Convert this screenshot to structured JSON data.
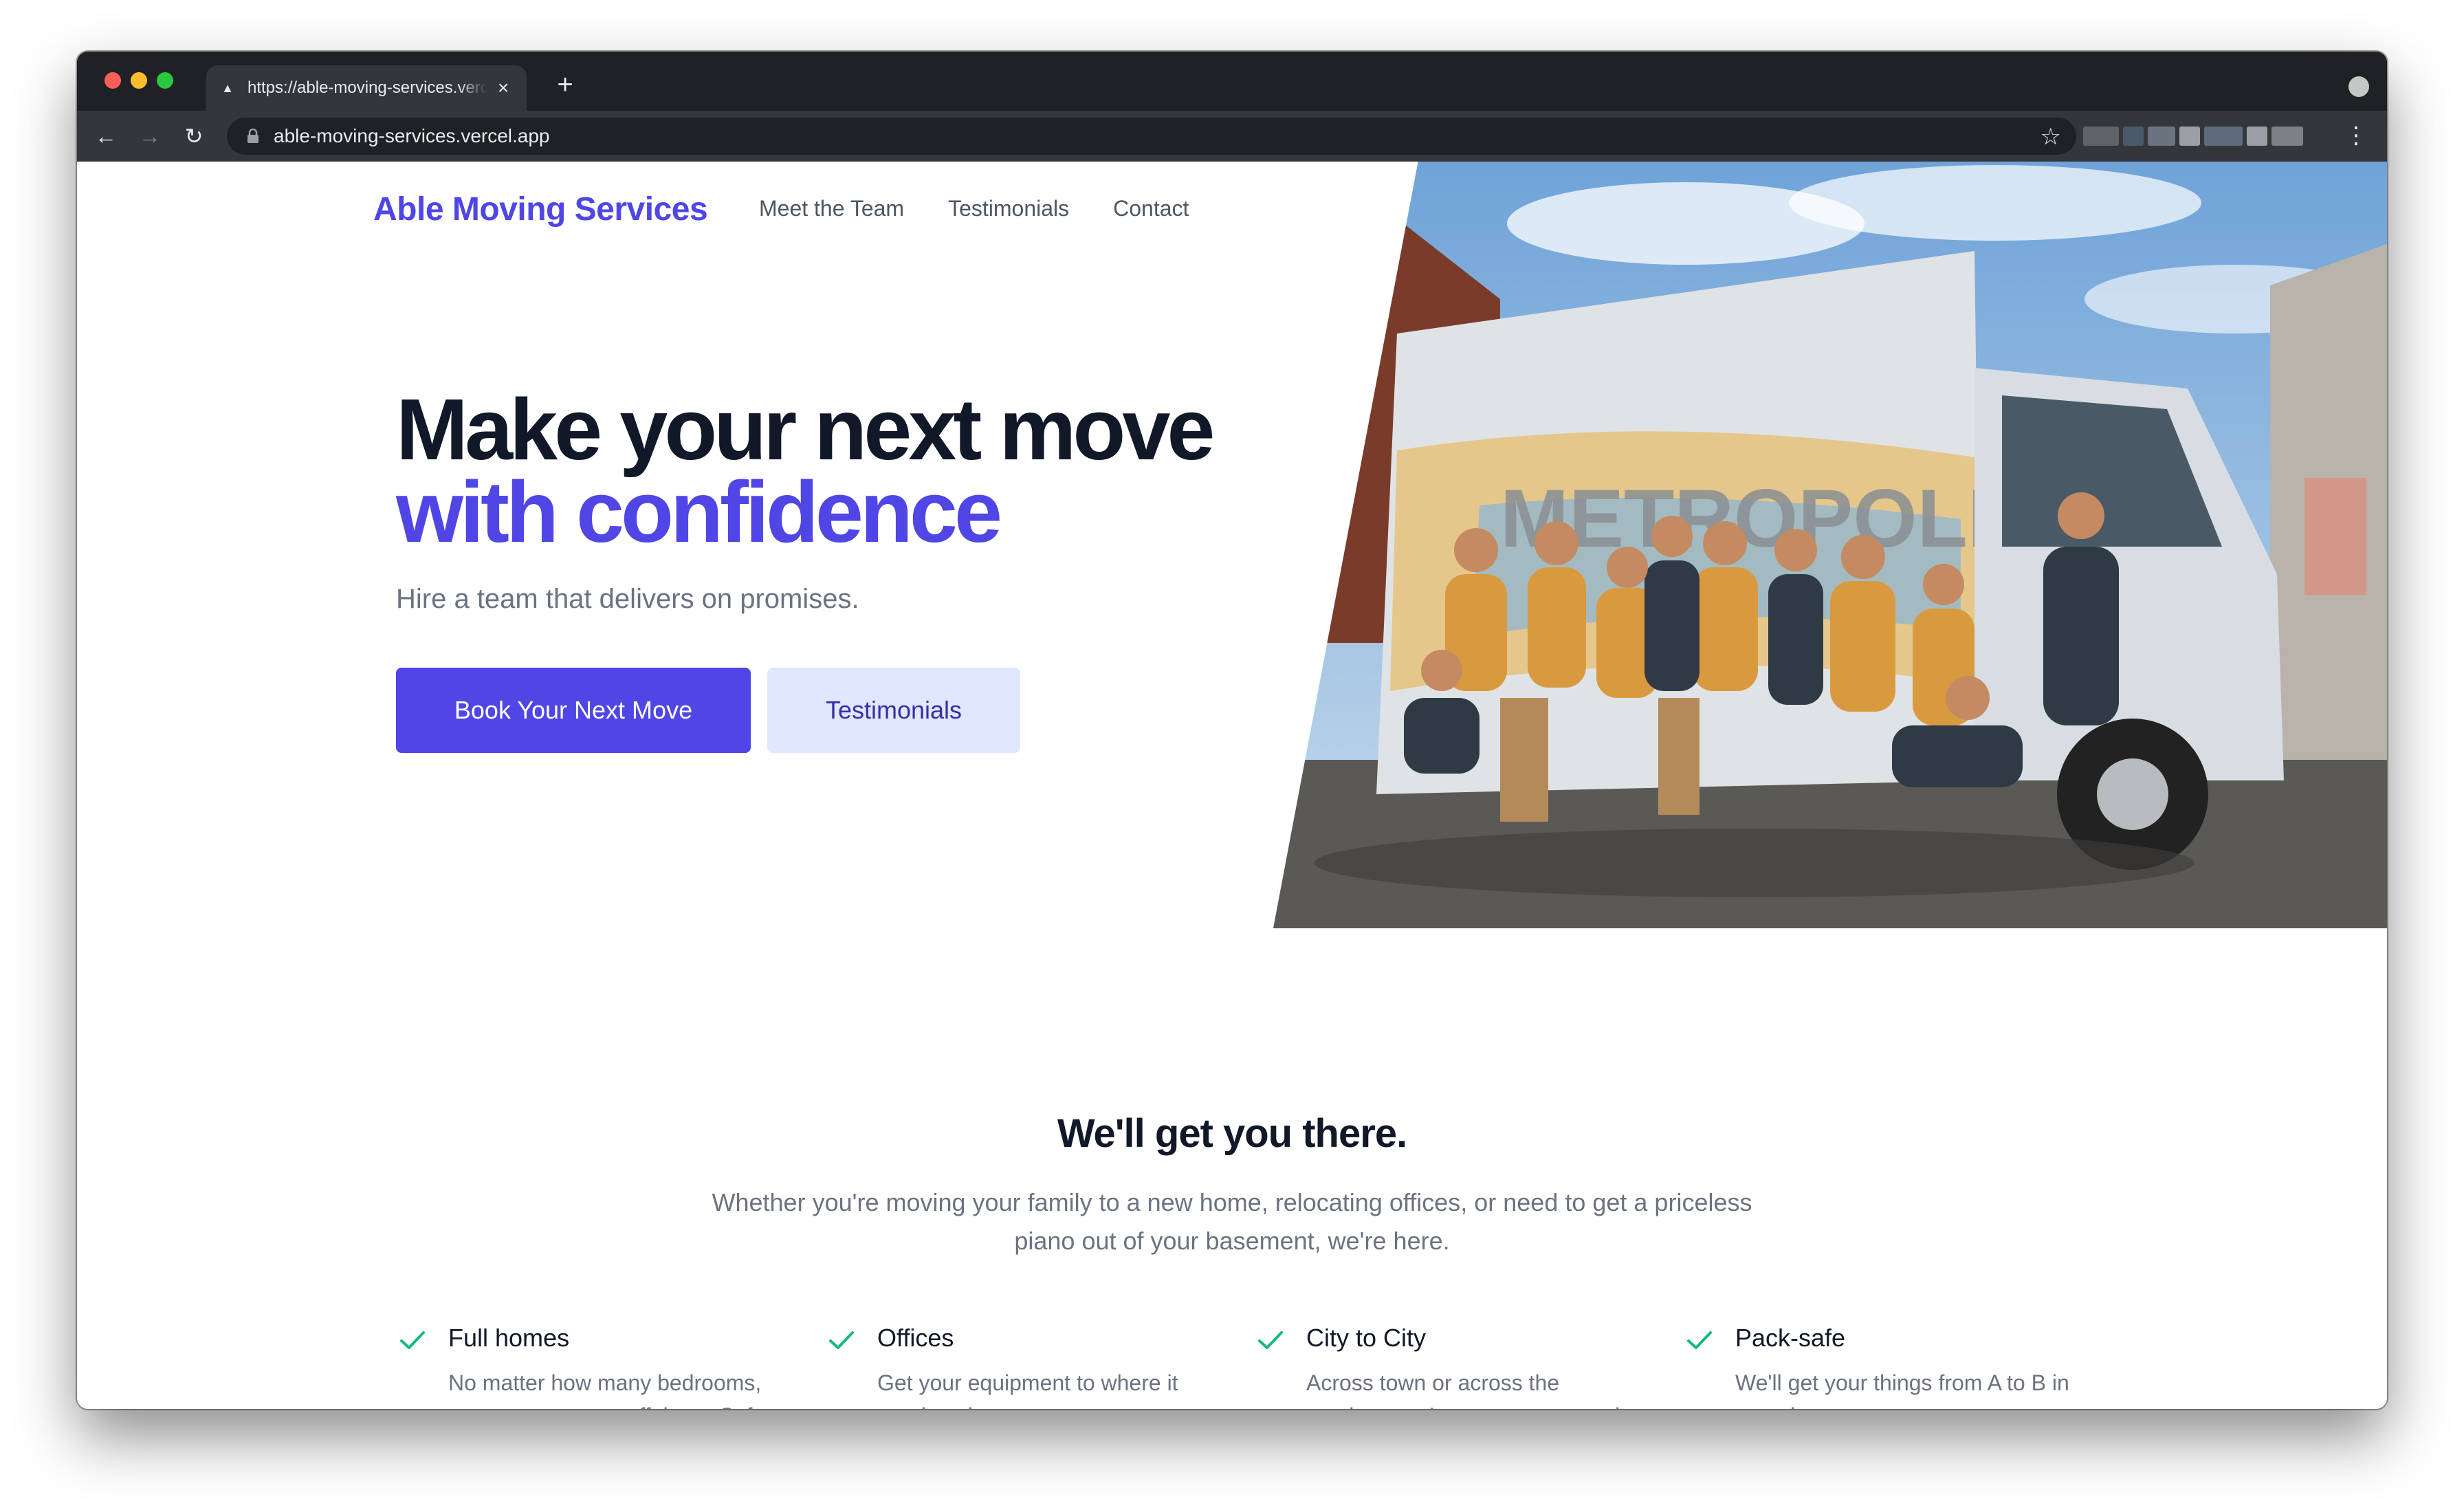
{
  "browser": {
    "tab_title": "https://able-moving-services.vercel.app",
    "url": "able-moving-services.vercel.app",
    "new_tab_label": "+",
    "close_label": "×"
  },
  "site": {
    "brand": "Able Moving Services",
    "nav": [
      "Meet the Team",
      "Testimonials",
      "Contact"
    ]
  },
  "hero": {
    "headline_line1": "Make your next move",
    "headline_line2": "with confidence",
    "subhead": "Hire a team that delivers on promises.",
    "primary_cta": "Book Your Next Move",
    "secondary_cta": "Testimonials",
    "photo_truck_text": "METROPOLIS"
  },
  "features": {
    "title": "We'll get you there.",
    "lead_line1": "Whether you're moving your family to a new home, relocating offices, or need to get a priceless",
    "lead_line2": "piano out of your basement, we're here.",
    "items": [
      {
        "title": "Full homes",
        "description": "No matter how many bedrooms, we can get your stuff there. Safe and sound."
      },
      {
        "title": "Offices",
        "description": "Get your equipment to where it needs to be."
      },
      {
        "title": "City to City",
        "description": "Across town or across the province, we've got you covered."
      },
      {
        "title": "Pack-safe",
        "description": "We'll get your things from A to B in one piece."
      }
    ]
  },
  "colors": {
    "brand": "#4f46e5",
    "brand_light": "#e0e7ff",
    "check": "#10b981",
    "heading": "#111827",
    "muted": "#6b7280"
  }
}
